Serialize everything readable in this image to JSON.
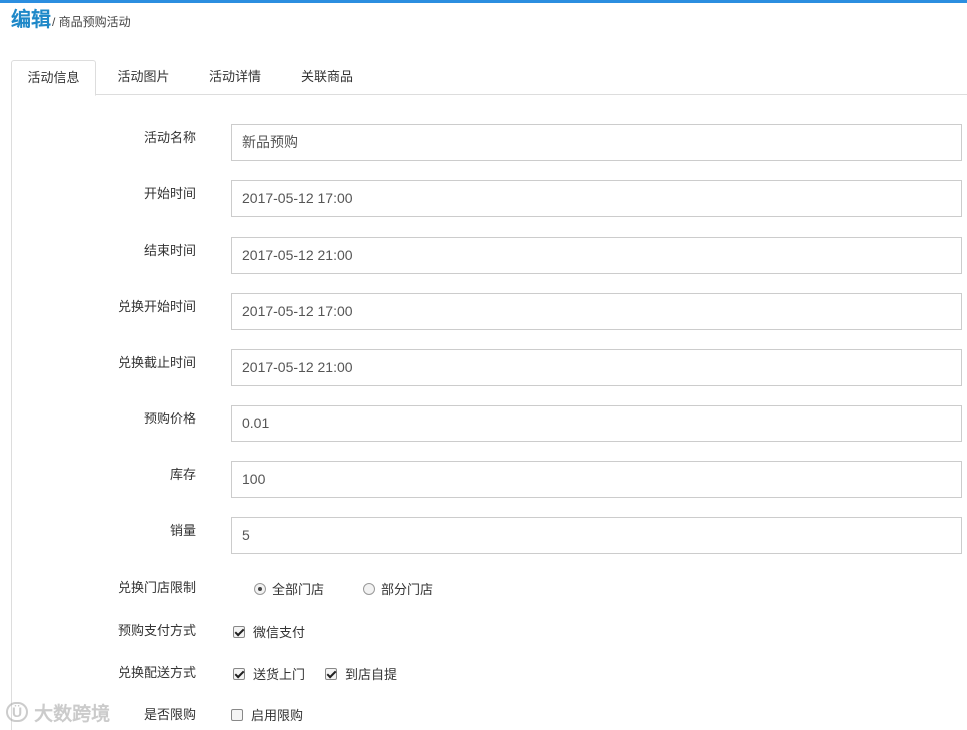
{
  "header": {
    "title": "编辑",
    "breadcrumb": "/ 商品预购活动"
  },
  "tabs": [
    {
      "label": "活动信息",
      "active": true
    },
    {
      "label": "活动图片"
    },
    {
      "label": "活动详情"
    },
    {
      "label": "关联商品"
    }
  ],
  "form": {
    "activity_name": {
      "label": "活动名称",
      "value": "新品预购"
    },
    "start_time": {
      "label": "开始时间",
      "value": "2017-05-12 17:00"
    },
    "end_time": {
      "label": "结束时间",
      "value": "2017-05-12 21:00"
    },
    "redeem_start": {
      "label": "兑换开始时间",
      "value": "2017-05-12 17:00"
    },
    "redeem_end": {
      "label": "兑换截止时间",
      "value": "2017-05-12 21:00"
    },
    "presale_price": {
      "label": "预购价格",
      "value": "0.01"
    },
    "stock": {
      "label": "库存",
      "value": "100"
    },
    "sales": {
      "label": "销量",
      "value": "5"
    },
    "store_limit": {
      "label": "兑换门店限制",
      "options": [
        {
          "label": "全部门店",
          "selected": true
        },
        {
          "label": "部分门店",
          "selected": false
        }
      ]
    },
    "payment_method": {
      "label": "预购支付方式",
      "options": [
        {
          "label": "微信支付",
          "checked": true
        }
      ]
    },
    "delivery_method": {
      "label": "兑换配送方式",
      "options": [
        {
          "label": "送货上门",
          "checked": true
        },
        {
          "label": "到店自提",
          "checked": true
        }
      ]
    },
    "purchase_limit": {
      "label": "是否限购",
      "options": [
        {
          "label": "启用限购",
          "checked": false
        }
      ]
    }
  },
  "watermark": {
    "logo": "Ü",
    "text": "大数跨境"
  },
  "colors": {
    "accent": "#2b8ee0",
    "title": "#1e88c8",
    "border": "#cccccc"
  }
}
